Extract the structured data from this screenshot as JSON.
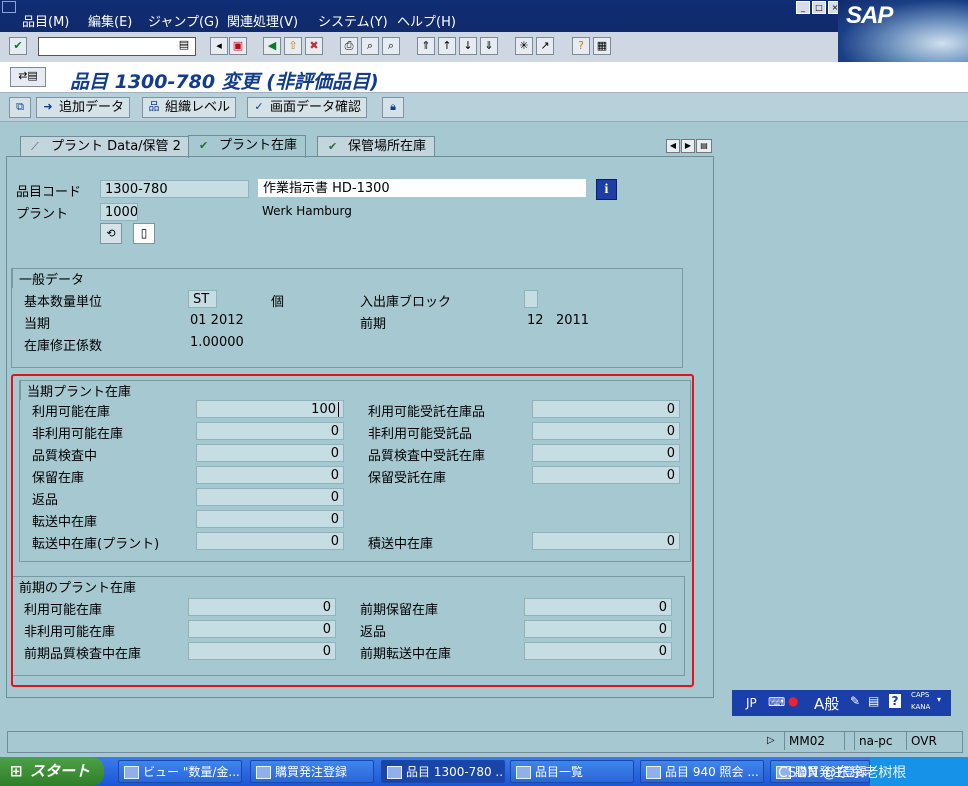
{
  "menu": [
    "品目(M)",
    "編集(E)",
    "ジャンプ(G)",
    "関連処理(V)",
    "システム(Y)",
    "ヘルプ(H)"
  ],
  "sap_logo": "SAP",
  "title": "品目 1300-780 変更 (非評価品目)",
  "app_toolbar": {
    "additional_data": "追加データ",
    "org_levels": "組織レベル",
    "check_screen_data": "画面データ確認"
  },
  "tabs": [
    {
      "label": "プラント Data/保管 2",
      "active": false
    },
    {
      "label": "プラント在庫",
      "active": true
    },
    {
      "label": "保管場所在庫",
      "active": false
    }
  ],
  "header": {
    "material_label": "品目コード",
    "material_value": "1300-780",
    "material_desc": "作業指示書 HD-1300",
    "plant_label": "プラント",
    "plant_value": "1000",
    "plant_desc": "Werk Hamburg"
  },
  "general": {
    "title": "一般データ",
    "base_unit_label": "基本数量単位",
    "base_unit_value": "ST",
    "base_unit_text": "個",
    "block_label": "入出庫ブロック",
    "current_period_label": "当期",
    "current_period_value": "01 2012",
    "prev_period_label": "前期",
    "prev_period_value": "12   2011",
    "factor_label": "在庫修正係数",
    "factor_value": "1.00000"
  },
  "current_stock": {
    "title": "当期プラント在庫",
    "left": [
      {
        "label": "利用可能在庫",
        "value": "100"
      },
      {
        "label": "非利用可能在庫",
        "value": "0"
      },
      {
        "label": "品質検査中",
        "value": "0"
      },
      {
        "label": "保留在庫",
        "value": "0"
      },
      {
        "label": "返品",
        "value": "0"
      },
      {
        "label": "転送中在庫",
        "value": "0"
      },
      {
        "label": "転送中在庫(プラント)",
        "value": "0"
      }
    ],
    "right": [
      {
        "label": "利用可能受託在庫品",
        "value": "0"
      },
      {
        "label": "非利用可能受託品",
        "value": "0"
      },
      {
        "label": "品質検査中受託在庫",
        "value": "0"
      },
      {
        "label": "保留受託在庫",
        "value": "0"
      }
    ],
    "transit_label": "積送中在庫",
    "transit_value": "0"
  },
  "prev_stock": {
    "title": "前期のプラント在庫",
    "left": [
      {
        "label": "利用可能在庫",
        "value": "0"
      },
      {
        "label": "非利用可能在庫",
        "value": "0"
      },
      {
        "label": "前期品質検査中在庫",
        "value": "0"
      }
    ],
    "right": [
      {
        "label": "前期保留在庫",
        "value": "0"
      },
      {
        "label": "返品",
        "value": "0"
      },
      {
        "label": "前期転送中在庫",
        "value": "0"
      }
    ]
  },
  "langbar": {
    "lang": "JP",
    "mode": "A般",
    "caps": "CAPS",
    "kana": "KANA"
  },
  "status": {
    "tcode": "MM02",
    "host": "na-pc",
    "mode": "OVR"
  },
  "taskbar": {
    "start": "スタート",
    "tasks": [
      "ビュー \"数量/金...",
      "購買発注登録",
      "品目 1300-780 ...",
      "品目一覧",
      "品目 940 照会 ...",
      "購買発注登録"
    ],
    "tray": "CSDN @东京老树根"
  }
}
